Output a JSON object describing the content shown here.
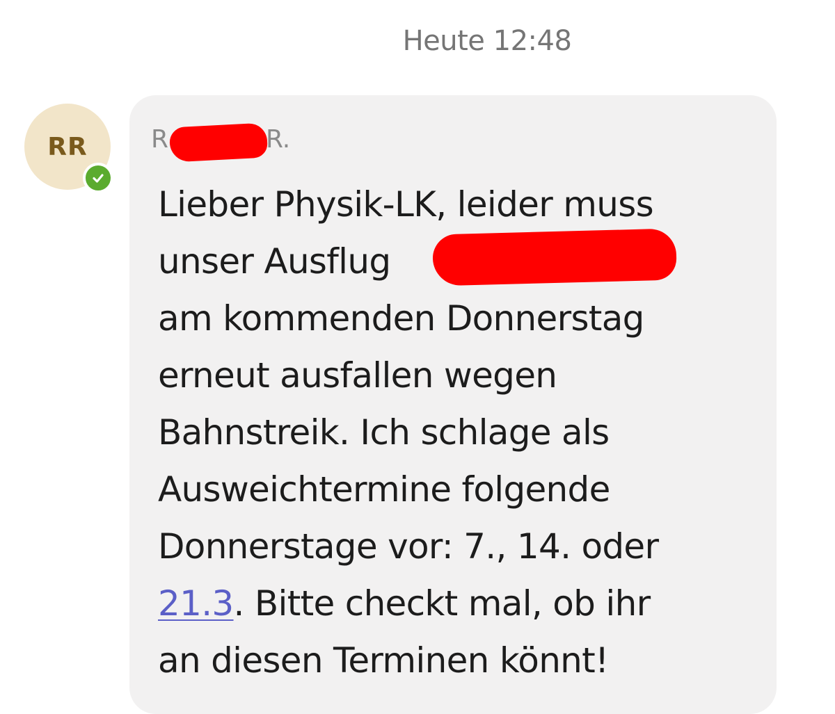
{
  "timestamp": "Heute 12:48",
  "avatar": {
    "initials": "RR",
    "status": "available"
  },
  "message": {
    "sender_prefix": "R",
    "sender_suffix": "R.",
    "lines": {
      "l1": "Lieber Physik-LK, leider muss",
      "l2": "unser Ausflug",
      "l3": "am kommenden Donnerstag",
      "l4": "erneut ausfallen wegen",
      "l5": "Bahnstreik. Ich schlage als",
      "l6": "Ausweichtermine folgende",
      "l7": "Donnerstage vor: 7., 14. oder",
      "l8_link": "21.3",
      "l8_rest": ". Bitte checkt mal, ob ihr",
      "l9": "an diesen Terminen könnt!"
    }
  },
  "colors": {
    "bubble": "#f2f1f1",
    "avatar_bg": "#f2e5c9",
    "avatar_text": "#7a5a1c",
    "status_green": "#5bab2e",
    "link": "#5b5fc7",
    "redaction": "#ff0000"
  },
  "icons": {
    "status": "checkmark-icon"
  }
}
